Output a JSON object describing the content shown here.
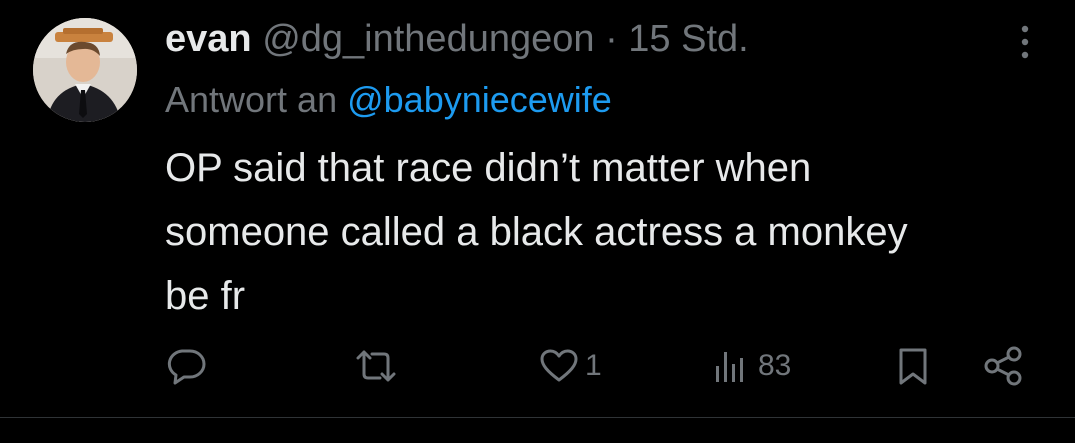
{
  "tweet": {
    "author_name": "evan",
    "handle": "@dg_inthedungeon",
    "separator": "·",
    "time": "15 Std.",
    "reply_prefix": "Antwort an",
    "reply_to": "@babyniecewife",
    "text_lines": [
      "OP said that race didn’t matter when",
      "someone called a black actress a monkey",
      "be fr"
    ]
  },
  "actions": {
    "reply_icon": "speech-bubble-icon",
    "retweet_icon": "retweet-icon",
    "like_icon": "heart-icon",
    "like_count": "1",
    "views_icon": "bar-chart-icon",
    "views_count": "83",
    "bookmark_icon": "bookmark-icon",
    "share_icon": "share-icon"
  },
  "colors": {
    "background": "#000000",
    "text": "#e7e9ea",
    "muted": "#71767b",
    "link": "#1d9bf0"
  }
}
